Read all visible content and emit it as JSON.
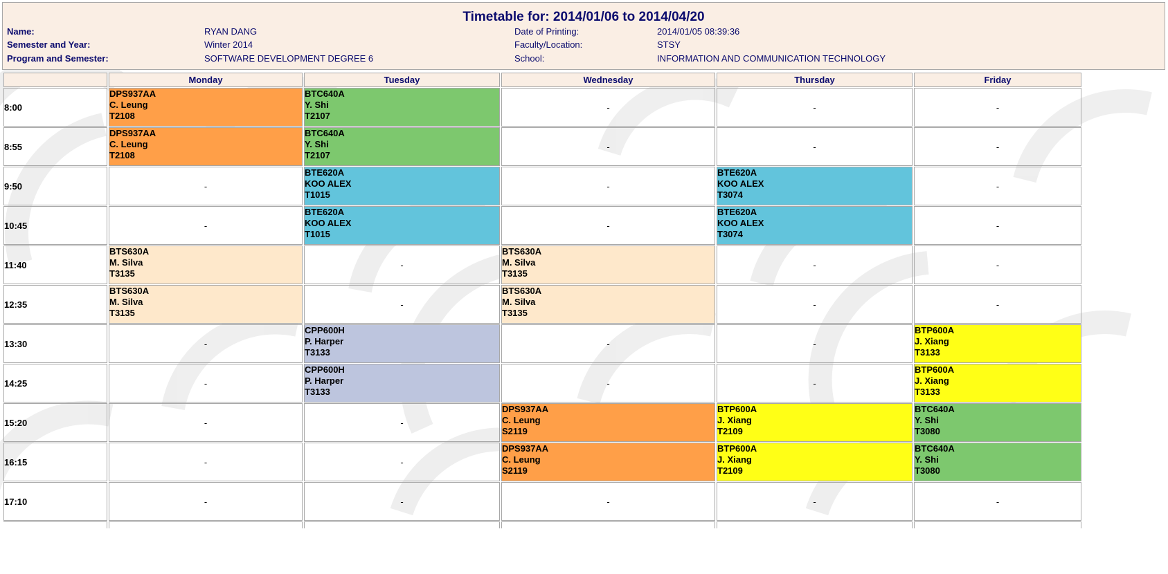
{
  "header": {
    "title": "Timetable for: 2014/01/06 to 2014/04/20",
    "name_label": "Name:",
    "name_value": "RYAN DANG",
    "semester_label": "Semester and Year:",
    "semester_value": "Winter 2014",
    "program_label": "Program and Semester:",
    "program_value": "SOFTWARE DEVELOPMENT DEGREE 6",
    "printing_label": "Date of Printing:",
    "printing_value": "2014/01/05 08:39:36",
    "faculty_label": "Faculty/Location:",
    "faculty_value": "STSY",
    "school_label": "School:",
    "school_value": "INFORMATION AND COMMUNICATION TECHNOLOGY"
  },
  "days": [
    "Monday",
    "Tuesday",
    "Wednesday",
    "Thursday",
    "Friday"
  ],
  "empty_marker": "-",
  "colors": {
    "DPS937AA": "#ff9f48",
    "BTC640A": "#7dc86e",
    "BTE620A": "#62c4dc",
    "BTS630A": "#fee8cb",
    "CPP600H": "#bdc5de",
    "BTP600A": "#ffff16"
  },
  "rows": [
    {
      "time": "8:00",
      "cells": [
        {
          "code": "DPS937AA",
          "prof": "C. Leung",
          "room": "T2108"
        },
        {
          "code": "BTC640A",
          "prof": "Y. Shi",
          "room": "T2107"
        },
        null,
        null,
        null
      ]
    },
    {
      "time": "8:55",
      "cells": [
        {
          "code": "DPS937AA",
          "prof": "C. Leung",
          "room": "T2108"
        },
        {
          "code": "BTC640A",
          "prof": "Y. Shi",
          "room": "T2107"
        },
        null,
        null,
        null
      ]
    },
    {
      "time": "9:50",
      "cells": [
        null,
        {
          "code": "BTE620A",
          "prof": "KOO ALEX",
          "room": "T1015"
        },
        null,
        {
          "code": "BTE620A",
          "prof": "KOO ALEX",
          "room": "T3074"
        },
        null
      ]
    },
    {
      "time": "10:45",
      "cells": [
        null,
        {
          "code": "BTE620A",
          "prof": "KOO ALEX",
          "room": "T1015"
        },
        null,
        {
          "code": "BTE620A",
          "prof": "KOO ALEX",
          "room": "T3074"
        },
        null
      ]
    },
    {
      "time": "11:40",
      "cells": [
        {
          "code": "BTS630A",
          "prof": "M. Silva",
          "room": "T3135"
        },
        null,
        {
          "code": "BTS630A",
          "prof": "M. Silva",
          "room": "T3135"
        },
        null,
        null
      ]
    },
    {
      "time": "12:35",
      "cells": [
        {
          "code": "BTS630A",
          "prof": "M. Silva",
          "room": "T3135"
        },
        null,
        {
          "code": "BTS630A",
          "prof": "M. Silva",
          "room": "T3135"
        },
        null,
        null
      ]
    },
    {
      "time": "13:30",
      "cells": [
        null,
        {
          "code": "CPP600H",
          "prof": "P. Harper",
          "room": "T3133"
        },
        null,
        null,
        {
          "code": "BTP600A",
          "prof": "J. Xiang",
          "room": "T3133"
        }
      ]
    },
    {
      "time": "14:25",
      "cells": [
        null,
        {
          "code": "CPP600H",
          "prof": "P. Harper",
          "room": "T3133"
        },
        null,
        null,
        {
          "code": "BTP600A",
          "prof": "J. Xiang",
          "room": "T3133"
        }
      ]
    },
    {
      "time": "15:20",
      "cells": [
        null,
        null,
        {
          "code": "DPS937AA",
          "prof": "C. Leung",
          "room": "S2119"
        },
        {
          "code": "BTP600A",
          "prof": "J. Xiang",
          "room": "T2109"
        },
        {
          "code": "BTC640A",
          "prof": "Y. Shi",
          "room": "T3080"
        }
      ]
    },
    {
      "time": "16:15",
      "cells": [
        null,
        null,
        {
          "code": "DPS937AA",
          "prof": "C. Leung",
          "room": "S2119"
        },
        {
          "code": "BTP600A",
          "prof": "J. Xiang",
          "room": "T2109"
        },
        {
          "code": "BTC640A",
          "prof": "Y. Shi",
          "room": "T3080"
        }
      ]
    },
    {
      "time": "17:10",
      "cells": [
        null,
        null,
        null,
        null,
        null
      ]
    }
  ]
}
